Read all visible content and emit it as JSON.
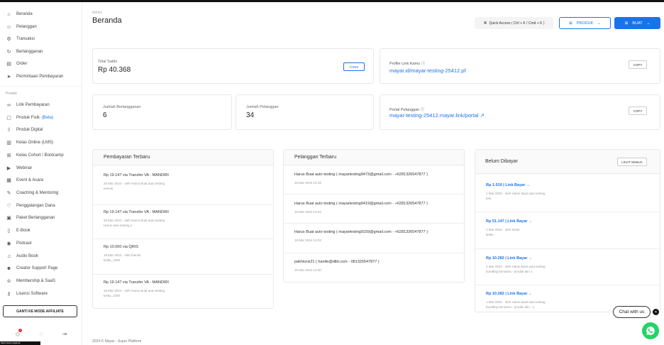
{
  "sidebar": {
    "items": [
      {
        "label": "Beranda",
        "icon": "home-icon",
        "glyph": "⌂"
      },
      {
        "label": "Pelanggan",
        "icon": "users-icon",
        "glyph": "☺"
      },
      {
        "label": "Transaksi",
        "icon": "gear-icon",
        "glyph": "⚙"
      },
      {
        "label": "Berlangganan",
        "icon": "refresh-icon",
        "glyph": "↻"
      },
      {
        "label": "Order",
        "icon": "order-icon",
        "glyph": "▤"
      },
      {
        "label": "Permintaan Pembayaran",
        "icon": "send-icon",
        "glyph": "➤"
      }
    ],
    "section_label": "Produk",
    "products": [
      {
        "label": "Link Pembayaran",
        "icon": "link-icon",
        "glyph": "∞"
      },
      {
        "label": "Produk Fisik",
        "beta": "(Beta)",
        "icon": "box-icon",
        "glyph": "▢"
      },
      {
        "label": "Produk Digital",
        "icon": "download-icon",
        "glyph": "⇩"
      },
      {
        "label": "Kelas Online (LMS)",
        "icon": "book-icon",
        "glyph": "▥"
      },
      {
        "label": "Kelas Cohort / Bootcamp",
        "icon": "cohort-icon",
        "glyph": "⊞"
      },
      {
        "label": "Webinar",
        "icon": "video-icon",
        "glyph": "▶"
      },
      {
        "label": "Event & Acara",
        "icon": "calendar-icon",
        "glyph": "▦"
      },
      {
        "label": "Coaching & Mentoring",
        "icon": "chat-icon",
        "glyph": "✎"
      },
      {
        "label": "Penggalangan Dana",
        "icon": "heart-icon",
        "glyph": "♡"
      },
      {
        "label": "Paket Berlangganan",
        "icon": "package-icon",
        "glyph": "▣"
      },
      {
        "label": "E-Book",
        "icon": "ebook-icon",
        "glyph": "▯"
      },
      {
        "label": "Podcast",
        "icon": "mic-icon",
        "glyph": "◉"
      },
      {
        "label": "Audio Book",
        "icon": "headphone-icon",
        "glyph": "♫"
      },
      {
        "label": "Creator Support Page",
        "icon": "support-icon",
        "glyph": "☻"
      },
      {
        "label": "Membership & SaaS",
        "icon": "membership-icon",
        "glyph": "♔"
      },
      {
        "label": "Lisensi Software",
        "icon": "key-icon",
        "glyph": "⚷"
      }
    ],
    "affiliate_button": "GANTI KE MODE AFFILIATE",
    "status_text": "https://web.mayar.id/"
  },
  "header": {
    "breadcrumb": "Admin",
    "title": "Beranda",
    "quick_access": "Quick Access ( Ctrl + K / Cmd + K )",
    "produk_button": "PRODUK",
    "buat_button": "BUAT"
  },
  "stats": {
    "saldo_label": "Total Saldo",
    "saldo_value": "Rp 40.368",
    "tarik_button": "TARIK",
    "link_label": "Profile Link Kamu",
    "link_url": "mayar.id/mayar-testing-25412.pf",
    "copy_label": "COPY",
    "langganan_label": "Jumlah Berlangganan",
    "langganan_value": "6",
    "pelanggan_label": "Jumlah Pelanggan",
    "pelanggan_value": "34",
    "portal_label": "Portal Pelanggan",
    "portal_url": "mayar-testing-25412.mayar.link/portal",
    "copy_label2": "COPY"
  },
  "payments": {
    "title": "Pembayaran Terbaru",
    "rows": [
      {
        "l1": "Rp 19.147 via Transfer VA - MANDIRI",
        "l2": "20 Mar 2024 · oleh Harus Buat auto testing",
        "l3": "events"
      },
      {
        "l1": "Rp 19.147 via Transfer VA - MANDIRI",
        "l2": "20 Mar 2024 · oleh Harus Buat auto testing",
        "l3": "Harus auto testing 1"
      },
      {
        "l1": "Rp 10.000 via QRIS",
        "l2": "19 Mar 2024 · oleh friends",
        "l3": "kelas_1000"
      },
      {
        "l1": "Rp 19.147 via Transfer VA - MANDIRI",
        "l2": "18 Mar 2024 · oleh Harus Buat auto testing",
        "l3": "kelas_1000"
      }
    ]
  },
  "customers": {
    "title": "Pelanggan Terbaru",
    "rows": [
      {
        "l1": "Harus Buat auto testing ( mayartesting9473@gmail.com - +6281326547877 )",
        "l2": "18 Mar 2024 12:33"
      },
      {
        "l1": "Harus Buat auto testing ( mayartesting9419@gmail.com - +6281326547877 )",
        "l2": "18 Mar 2024 12:03"
      },
      {
        "l1": "Harus Buat auto testing ( mayartesting9159@gmail.com - +6281326547877 )",
        "l2": "18 Mar 2024 12:03"
      },
      {
        "l1": "pakhtorsi21 ( hanife@dibt.com - 081326547877 )",
        "l2": "15 Mar 2024 14:00"
      }
    ]
  },
  "unpaid": {
    "title": "Belum Dibayar",
    "button": "LIHAT SEMUA",
    "rows": [
      {
        "l1": "Rp 1.019 | Link Bayar →",
        "l2": "1 Mar 2024 · oleh Harus Buat auto testing",
        "l3": "test"
      },
      {
        "l1": "Rp 51.147 | Link Bayar →",
        "l2": "1 Mar 2024 · oleh tester",
        "l3": "kelas"
      },
      {
        "l1": "Rp 10.282 | Link Bayar →",
        "l2": "1 Mar 2024 · oleh Harus Buat auto testing",
        "l3": "bundling bersama - produk lain 1"
      },
      {
        "l1": "Rp 10.282 | Link Bayar →",
        "l2": "1 Mar 2024 · oleh Harus Buat auto testing",
        "l3": "bundling bersama - produk lain - 1"
      }
    ]
  },
  "chat": {
    "label": "Chat with us"
  },
  "footer": "2024 © Mayar - Super Platform",
  "colors": {
    "accent": "#1a73e8",
    "whatsapp": "#25d366"
  }
}
